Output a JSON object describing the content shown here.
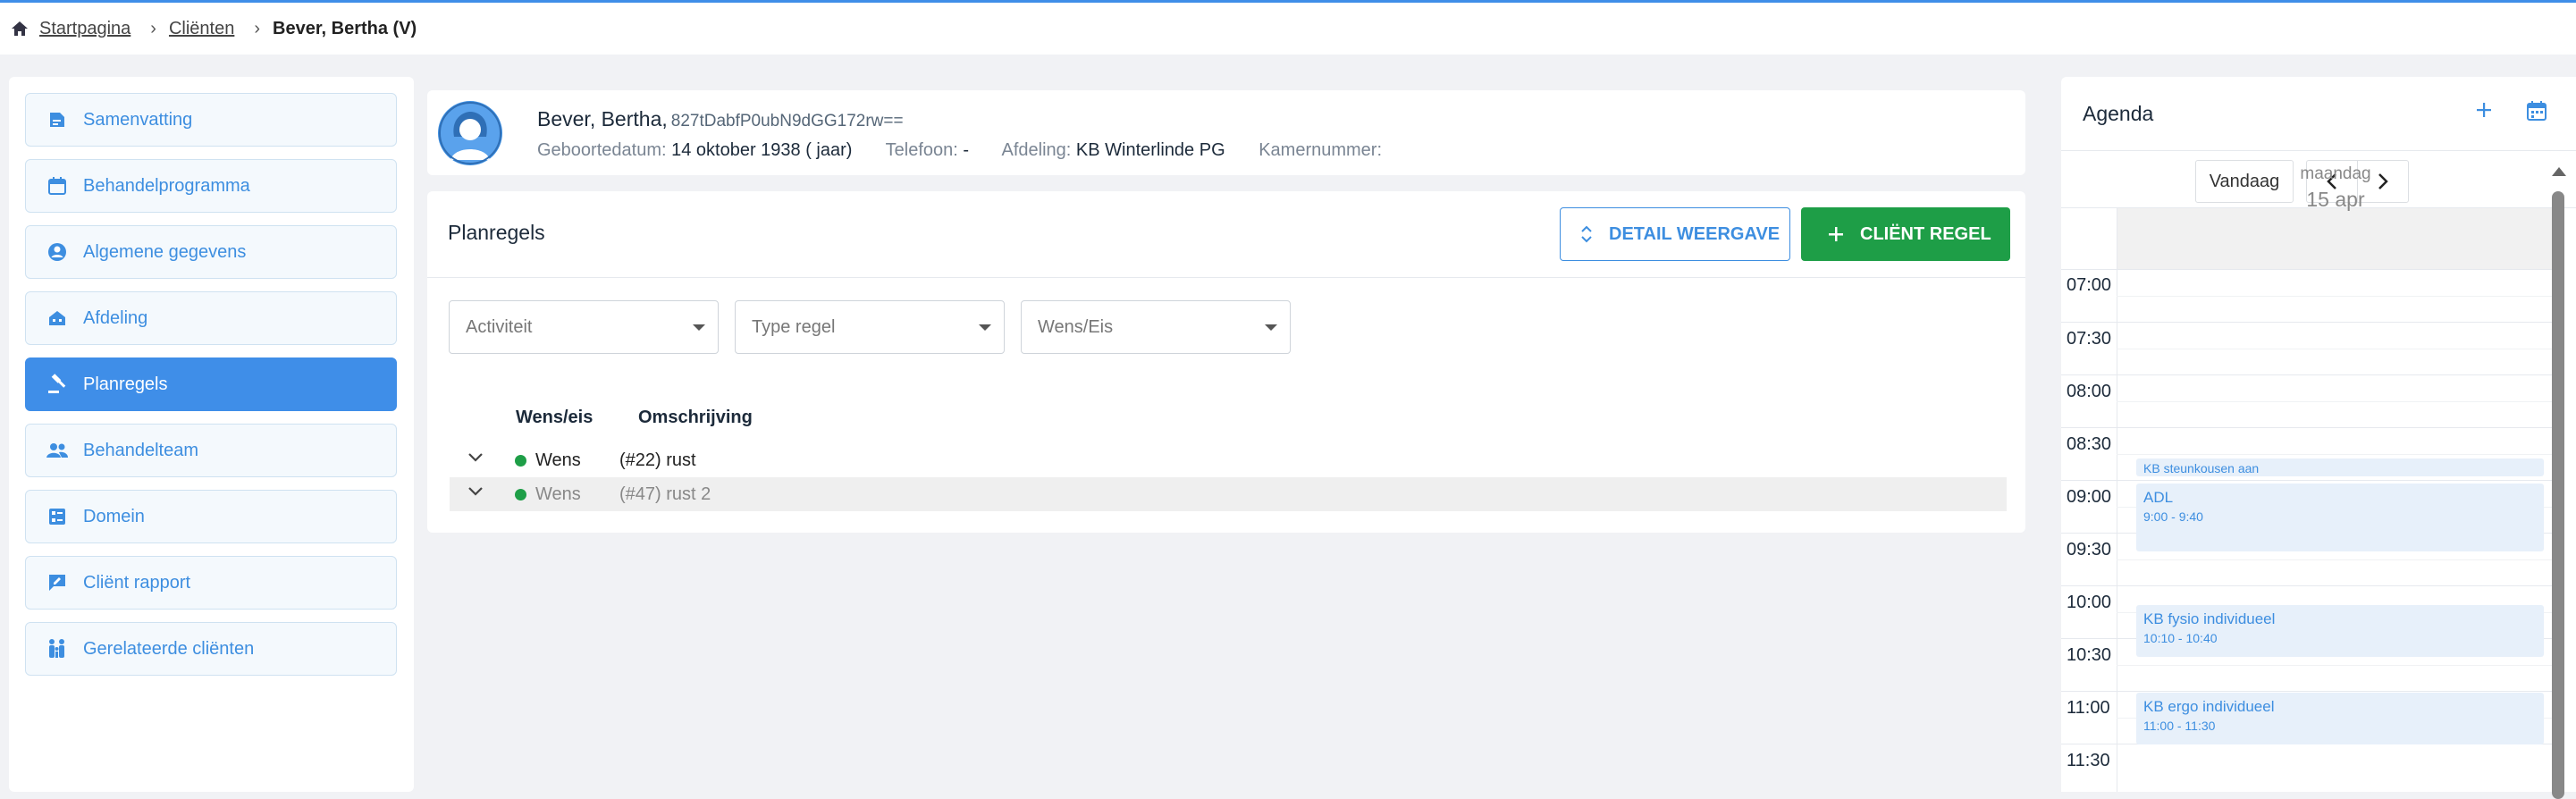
{
  "breadcrumb": {
    "home": "Startpagina",
    "clients": "Cliënten",
    "current": "Bever, Bertha (V)"
  },
  "sidebar": {
    "items": [
      {
        "label": "Samenvatting",
        "icon": "summary-icon"
      },
      {
        "label": "Behandelprogramma",
        "icon": "calendar-icon"
      },
      {
        "label": "Algemene gegevens",
        "icon": "account-circle-icon"
      },
      {
        "label": "Afdeling",
        "icon": "building-icon"
      },
      {
        "label": "Planregels",
        "icon": "gavel-icon",
        "active": true
      },
      {
        "label": "Behandelteam",
        "icon": "people-icon"
      },
      {
        "label": "Domein",
        "icon": "domain-list-icon"
      },
      {
        "label": "Cliënt rapport",
        "icon": "report-icon"
      },
      {
        "label": "Gerelateerde cliënten",
        "icon": "family-icon"
      }
    ]
  },
  "patient": {
    "name": "Bever, Bertha,",
    "hash": "827tDabfP0ubN9dGG172rw==",
    "dob_label": "Geboortedatum:",
    "dob_value": "14 oktober 1938 ( jaar)",
    "phone_label": "Telefoon:",
    "phone_value": "-",
    "dept_label": "Afdeling:",
    "dept_value": "KB Winterlinde PG",
    "room_label": "Kamernummer:",
    "room_value": ""
  },
  "plan": {
    "title": "Planregels",
    "detail_button": "DETAIL WEERGAVE",
    "add_button": "CLIËNT REGEL",
    "filters": [
      "Activiteit",
      "Type regel",
      "Wens/Eis"
    ],
    "columns": [
      "Wens/eis",
      "Omschrijving"
    ],
    "rows": [
      {
        "type": "Wens",
        "description": "(#22) rust"
      },
      {
        "type": "Wens",
        "description": "(#47) rust 2"
      }
    ]
  },
  "agenda": {
    "title": "Agenda",
    "today_button": "Vandaag",
    "day_name": "maandag",
    "day_date": "15 apr",
    "times": [
      "07:00",
      "07:30",
      "08:00",
      "08:30",
      "09:00",
      "09:30",
      "10:00",
      "10:30",
      "11:00",
      "11:30"
    ],
    "events": [
      {
        "title": "KB steunkousen aan",
        "hours": ""
      },
      {
        "title": "ADL",
        "hours": "9:00 - 9:40"
      },
      {
        "title": "KB fysio individueel",
        "hours": "10:10 - 10:40"
      },
      {
        "title": "KB ergo individueel",
        "hours": "11:00 - 11:30"
      }
    ]
  },
  "colors": {
    "primary": "#3f8ee8",
    "success": "#1e9e47"
  }
}
